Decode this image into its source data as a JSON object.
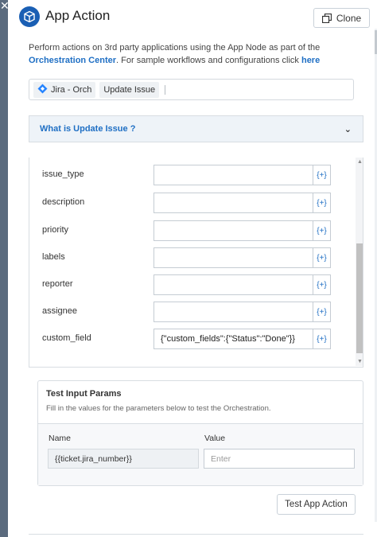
{
  "header": {
    "title": "App Action",
    "clone_label": "Clone"
  },
  "description": {
    "text_part1": "Perform actions on 3rd party applications using the App Node as part of the ",
    "link_orchestration": "Orchestration Center",
    "text_part2": ". For sample workflows and configurations click ",
    "link_here": "here"
  },
  "chips": {
    "app": "Jira - Orch",
    "action": "Update Issue"
  },
  "accordion": {
    "label": "What is Update Issue ?"
  },
  "fields": [
    {
      "label": "issue_type",
      "value": ""
    },
    {
      "label": "description",
      "value": ""
    },
    {
      "label": "priority",
      "value": ""
    },
    {
      "label": "labels",
      "value": ""
    },
    {
      "label": "reporter",
      "value": ""
    },
    {
      "label": "assignee",
      "value": ""
    },
    {
      "label": "custom_field",
      "value": "{\"custom_fields\":{\"Status\":\"Done\"}}"
    }
  ],
  "plus_label": "{+}",
  "test_params": {
    "title": "Test Input Params",
    "subtitle": "Fill in the values for the parameters below to test the Orchestration.",
    "col_name": "Name",
    "col_value": "Value",
    "name_value": "{{ticket.jira_number}}",
    "value_placeholder": "Enter"
  },
  "test_button": "Test App Action",
  "colors": {
    "accent": "#1f6fc4",
    "logo": "#1a5fb4",
    "jira": "#2684ff"
  }
}
